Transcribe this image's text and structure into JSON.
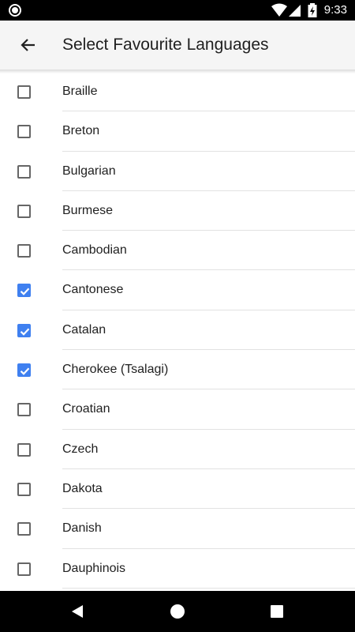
{
  "status_bar": {
    "time": "9:33",
    "icons": [
      "record-icon",
      "wifi-icon",
      "signal-icon",
      "battery-charging-icon"
    ]
  },
  "app_bar": {
    "title": "Select Favourite Languages",
    "back_icon": "arrow-back-icon"
  },
  "colors": {
    "accent": "#3f80f0",
    "app_bar_bg": "#f5f5f5",
    "text": "#212121"
  },
  "languages": [
    {
      "label": "Braille",
      "checked": false
    },
    {
      "label": "Breton",
      "checked": false
    },
    {
      "label": "Bulgarian",
      "checked": false
    },
    {
      "label": "Burmese",
      "checked": false
    },
    {
      "label": "Cambodian",
      "checked": false
    },
    {
      "label": "Cantonese",
      "checked": true
    },
    {
      "label": "Catalan",
      "checked": true
    },
    {
      "label": "Cherokee (Tsalagi)",
      "checked": true
    },
    {
      "label": "Croatian",
      "checked": false
    },
    {
      "label": "Czech",
      "checked": false
    },
    {
      "label": "Dakota",
      "checked": false
    },
    {
      "label": "Danish",
      "checked": false
    },
    {
      "label": "Dauphinois",
      "checked": false
    }
  ],
  "nav_bar": {
    "buttons": [
      "back-triangle-icon",
      "home-circle-icon",
      "recents-square-icon"
    ]
  }
}
